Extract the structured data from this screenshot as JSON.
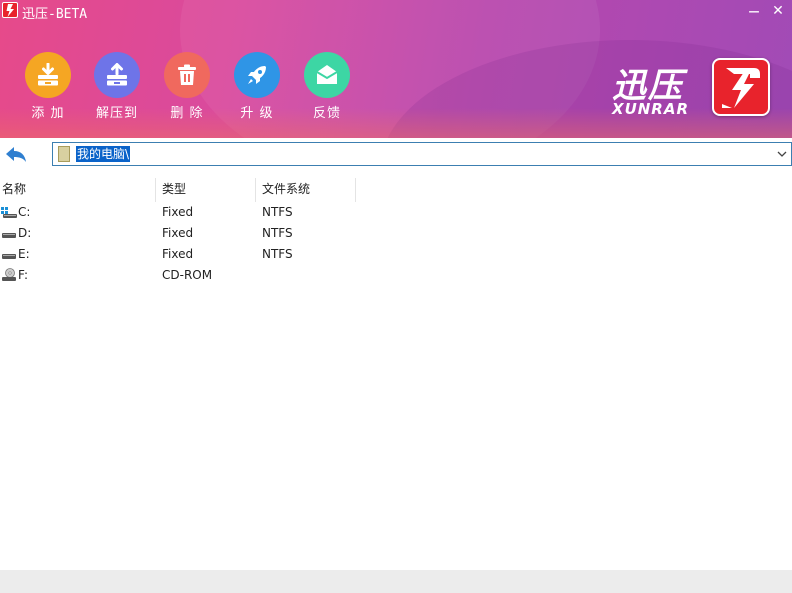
{
  "window": {
    "title": "迅压-BETA",
    "minimize_glyph": "—",
    "close_glyph": "✕"
  },
  "toolbar": {
    "items": [
      {
        "label": "添 加",
        "icon": "add-archive-icon",
        "color": "#f5a623"
      },
      {
        "label": "解压到",
        "icon": "extract-to-icon",
        "color": "#6e74e8"
      },
      {
        "label": "删 除",
        "icon": "delete-trash-icon",
        "color": "#f0695e"
      },
      {
        "label": "升 级",
        "icon": "rocket-upgrade-icon",
        "color": "#2f95e6"
      },
      {
        "label": "反馈",
        "icon": "feedback-mail-icon",
        "color": "#3dd6a4"
      }
    ]
  },
  "brand": {
    "name_cn": "迅压",
    "name_en": "XUNRAR",
    "color": "#e8232c"
  },
  "address": {
    "path": "我的电脑\\"
  },
  "list": {
    "columns": [
      "名称",
      "类型",
      "文件系统"
    ],
    "rows": [
      {
        "name": "C:",
        "type": "Fixed",
        "fs": "NTFS",
        "icon": "system-drive-icon"
      },
      {
        "name": "D:",
        "type": "Fixed",
        "fs": "NTFS",
        "icon": "hard-drive-icon"
      },
      {
        "name": "E:",
        "type": "Fixed",
        "fs": "NTFS",
        "icon": "hard-drive-icon"
      },
      {
        "name": "F:",
        "type": "CD-ROM",
        "fs": "",
        "icon": "cd-drive-icon"
      }
    ]
  }
}
